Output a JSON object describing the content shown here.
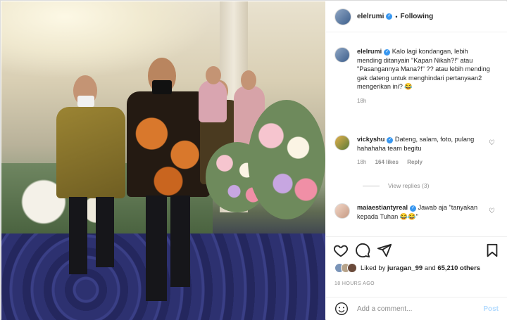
{
  "header": {
    "username": "elelrumi",
    "separator": "•",
    "follow_label": "Following"
  },
  "caption": {
    "username": "elelrumi",
    "text": "Kalo lagi kondangan, lebih mending ditanyain \"Kapan Nikah?!\" atau \"Pasangannya Mana?!\" ?? atau lebih mending gak dateng untuk menghindari pertanyaan2 mengerikan ini? 😂",
    "time": "18h"
  },
  "comments": [
    {
      "username": "vickyshu",
      "text": "Dateng, salam, foto, pulang hahahaha team begitu",
      "time": "18h",
      "likes": "164 likes",
      "reply_label": "Reply"
    },
    {
      "username": "maiaestiantyreal",
      "text": "Jawab aja \"tanyakan kepada Tuhan 😂😂\""
    }
  ],
  "view_replies": "View replies (3)",
  "likes": {
    "prefix": "Liked by",
    "user": "juragan_99",
    "middle": "and",
    "count": "65,210 others"
  },
  "timestamp": "18 HOURS AGO",
  "add_comment": {
    "placeholder": "Add a comment...",
    "post_label": "Post"
  },
  "colors": {
    "verified": "#3897f0",
    "post_disabled": "#b3dbff",
    "muted": "#8e8e8e"
  },
  "icons": [
    "verified-icon",
    "heart-icon",
    "comment-icon",
    "share-icon",
    "bookmark-icon",
    "emoji-icon"
  ]
}
